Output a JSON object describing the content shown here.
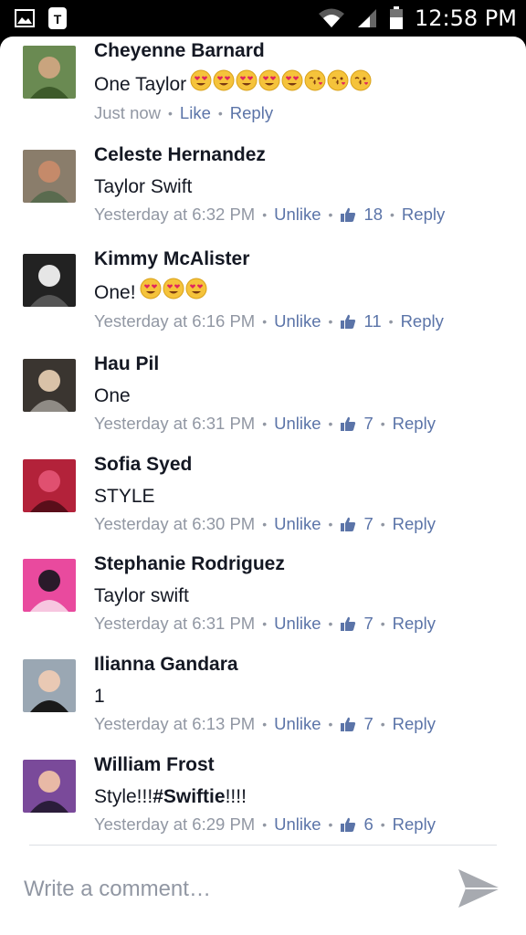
{
  "status_bar": {
    "time": "12:58 PM",
    "left_icons": [
      "image-notification-icon",
      "t-mobile-icon"
    ],
    "right_icons": [
      "wifi-icon",
      "signal-icon",
      "battery-icon"
    ]
  },
  "colors": {
    "name": "#141823",
    "meta": "#9197a3",
    "link": "#5b74a8",
    "background": "#ffffff"
  },
  "comments": [
    {
      "author": "Cheyenne Barnard",
      "text": "One Taylor",
      "emojis": [
        "heart-eyes",
        "heart-eyes",
        "heart-eyes",
        "heart-eyes",
        "heart-eyes",
        "kiss",
        "kiss",
        "kiss"
      ],
      "time": "Just now",
      "action": "Like",
      "likes": null,
      "reply": "Reply",
      "avatar_colors": [
        "#6a8a52",
        "#c9a47e",
        "#3d5a2a"
      ]
    },
    {
      "author": "Celeste Hernandez",
      "text": "Taylor Swift",
      "emojis": [],
      "time": "Yesterday at 6:32 PM",
      "action": "Unlike",
      "likes": "18",
      "reply": "Reply",
      "avatar_colors": [
        "#8a7d6b",
        "#c58a6a",
        "#5a6b4f"
      ]
    },
    {
      "author": "Kimmy McAlister",
      "text": "One!",
      "emojis": [
        "heart-eyes",
        "heart-eyes",
        "heart-eyes"
      ],
      "time": "Yesterday at 6:16 PM",
      "action": "Unlike",
      "likes": "11",
      "reply": "Reply",
      "avatar_colors": [
        "#222222",
        "#e6e6e6",
        "#555555"
      ]
    },
    {
      "author": "Hau Pil",
      "text": "One",
      "emojis": [],
      "time": "Yesterday at 6:31 PM",
      "action": "Unlike",
      "likes": "7",
      "reply": "Reply",
      "avatar_colors": [
        "#3a3530",
        "#d9c2a8",
        "#8f8b85"
      ]
    },
    {
      "author": "Sofia Syed",
      "text": "STYLE",
      "emojis": [],
      "time": "Yesterday at 6:30 PM",
      "action": "Unlike",
      "likes": "7",
      "reply": "Reply",
      "avatar_colors": [
        "#b3223a",
        "#e05070",
        "#5a0e1a"
      ]
    },
    {
      "author": "Stephanie Rodriguez",
      "text": "Taylor swift",
      "emojis": [],
      "time": "Yesterday at 6:31 PM",
      "action": "Unlike",
      "likes": "7",
      "reply": "Reply",
      "avatar_colors": [
        "#e94a9e",
        "#2a1a2a",
        "#f7c6e0"
      ]
    },
    {
      "author": "Ilianna Gandara",
      "text": "1",
      "emojis": [],
      "time": "Yesterday at 6:13 PM",
      "action": "Unlike",
      "likes": "7",
      "reply": "Reply",
      "avatar_colors": [
        "#9aa7b3",
        "#e9c9b4",
        "#1a1a1a"
      ]
    },
    {
      "author": "William Frost",
      "text": "Style!!! ",
      "hashtag": "#Swiftie",
      "text_after": "!!!!",
      "emojis": [],
      "time": "Yesterday at 6:29 PM",
      "action": "Unlike",
      "likes": "6",
      "reply": "Reply",
      "avatar_colors": [
        "#7a4a9a",
        "#e8b9a6",
        "#2b1d3a"
      ]
    }
  ],
  "composer": {
    "placeholder": "Write a comment…",
    "send_icon": "send-icon"
  }
}
